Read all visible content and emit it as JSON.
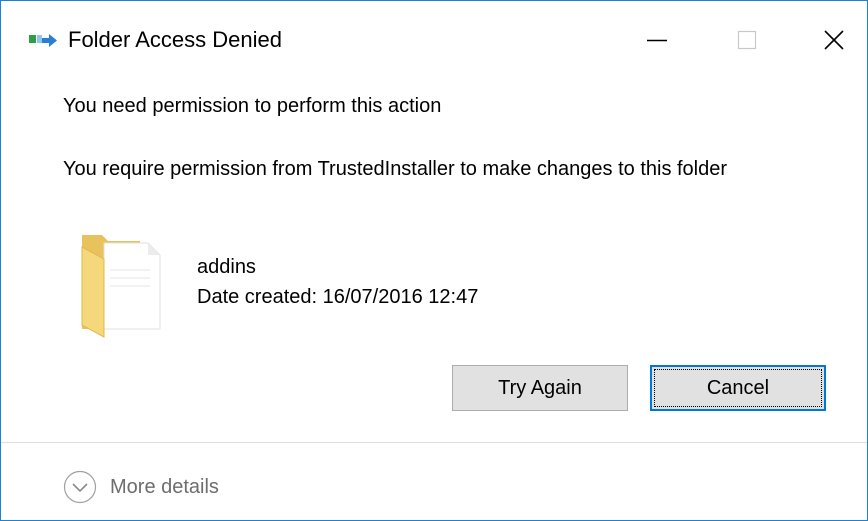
{
  "window": {
    "title": "Folder Access Denied",
    "icon": "folder-move-icon",
    "controls": {
      "minimize": "minimize-icon",
      "maximize": "maximize-icon",
      "close": "close-icon"
    }
  },
  "content": {
    "heading": "You need permission to perform this action",
    "message": "You require permission from TrustedInstaller to make changes to this folder",
    "item": {
      "icon": "folder-icon",
      "name": "addins",
      "date_created": "Date created: 16/07/2016 12:47"
    }
  },
  "buttons": {
    "try_again": "Try Again",
    "cancel": "Cancel"
  },
  "footer": {
    "more_details": "More details",
    "icon": "chevron-down-icon"
  },
  "colors": {
    "window_border": "#1883d7",
    "button_face": "#e1e1e1",
    "focus_border": "#0078d7",
    "muted_text": "#6d6d6d"
  }
}
